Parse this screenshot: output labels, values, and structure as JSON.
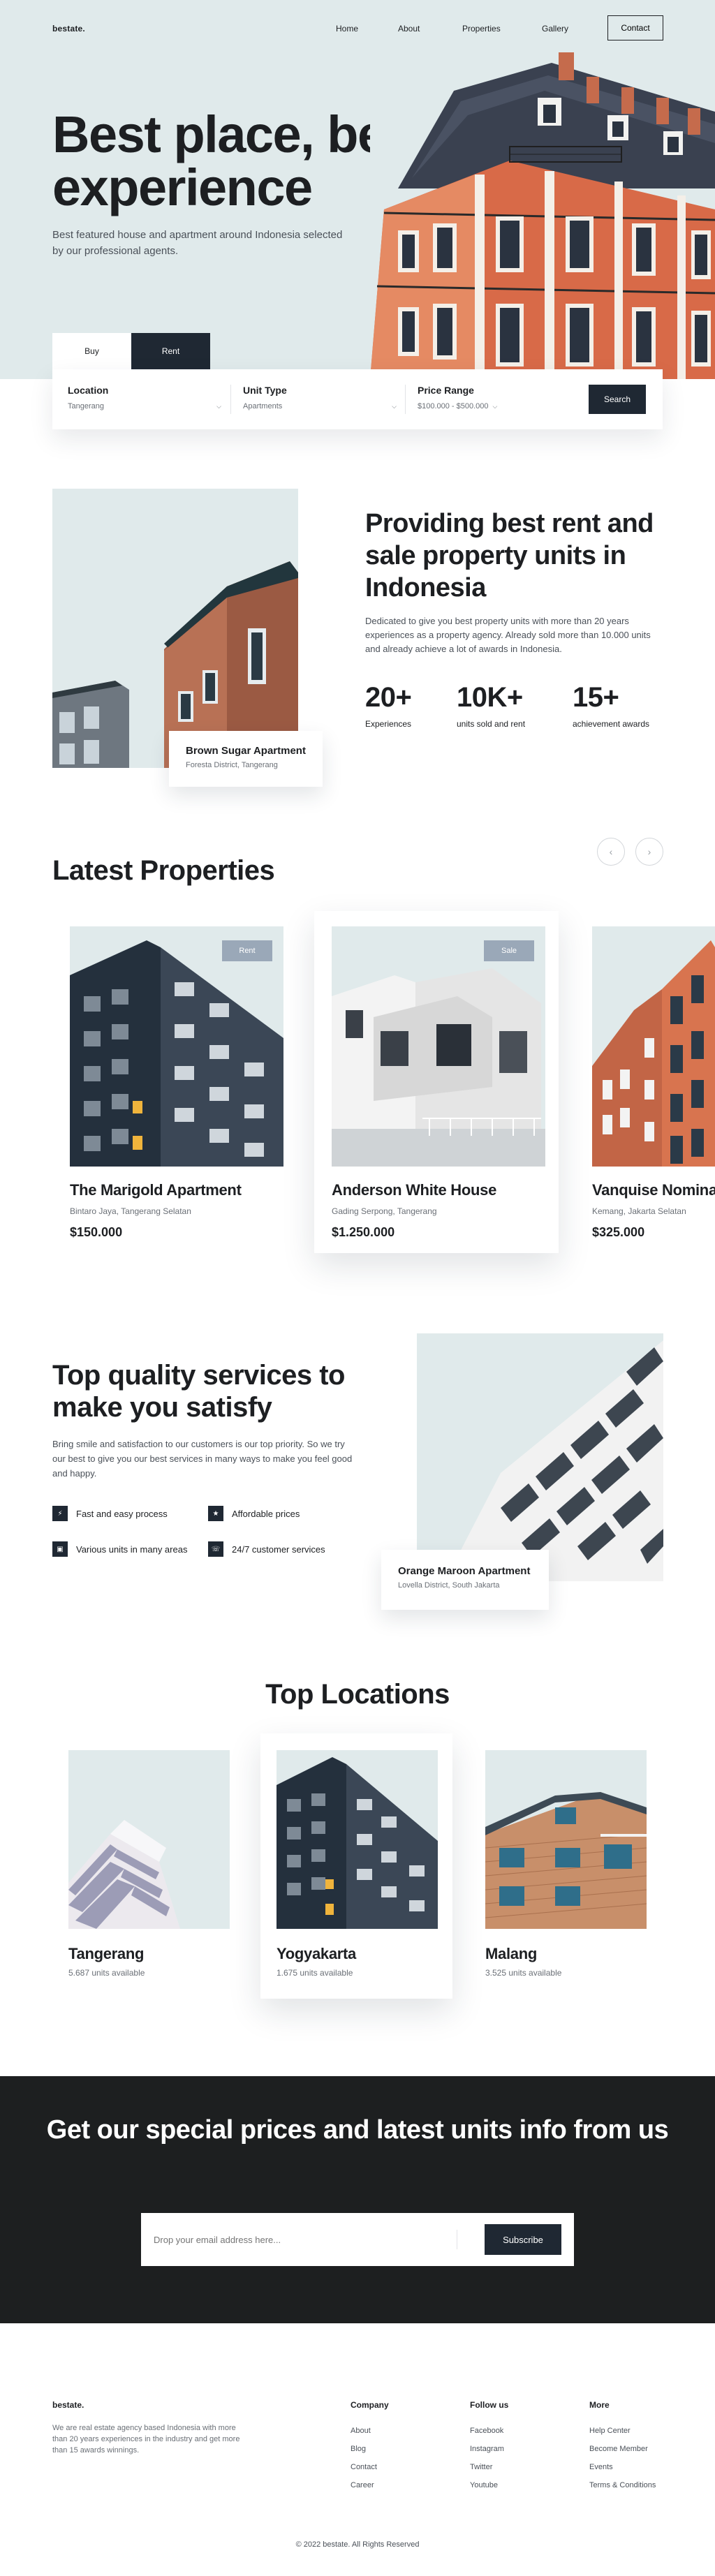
{
  "nav": {
    "logo": "bestate.",
    "links": [
      "Home",
      "About",
      "Properties",
      "Gallery"
    ],
    "contact": "Contact"
  },
  "hero": {
    "title": "Best place, best experience",
    "subtitle": "Best featured house and apartment around Indonesia selected by our professional agents.",
    "tabs": [
      "Buy",
      "Rent"
    ],
    "active_tab": "Buy",
    "fields": [
      {
        "label": "Location",
        "value": "Tangerang"
      },
      {
        "label": "Unit Type",
        "value": "Apartments"
      },
      {
        "label": "Price Range",
        "value": "$100.000 - $500.000"
      }
    ],
    "search_button": "Search"
  },
  "about": {
    "card_title": "Brown Sugar Apartment",
    "card_location": "Foresta District, Tangerang",
    "title": "Providing best rent and sale property units in Indonesia",
    "description": "Dedicated to give you best property units with more than 20 years experiences as a property agency. Already sold more than 10.000 units and already achieve a lot of awards in Indonesia.",
    "stats": [
      {
        "value": "20+",
        "label": "Experiences"
      },
      {
        "value": "10K+",
        "label": "units sold and rent"
      },
      {
        "value": "15+",
        "label": "achievement awards"
      }
    ]
  },
  "latest": {
    "title": "Latest Properties",
    "prev_icon": "chevron-left-icon",
    "next_icon": "chevron-right-icon",
    "properties": [
      {
        "name": "The Marigold Apartment",
        "location": "Bintaro Jaya, Tangerang Selatan",
        "price": "$150.000",
        "badge": "Rent"
      },
      {
        "name": "Anderson White House",
        "location": "Gading Serpong, Tangerang",
        "price": "$1.250.000",
        "badge": "Sale"
      },
      {
        "name": "Vanquise Nominal",
        "location": "Kemang, Jakarta Selatan",
        "price": "$325.000",
        "badge": ""
      }
    ]
  },
  "services": {
    "title": "Top quality services to make you satisfy",
    "description": "Bring smile and satisfaction to our customers is our top priority. So we try our best to give you our best services in many ways to make you feel good and happy.",
    "items": [
      {
        "label": "Fast and easy process",
        "icon": "lightning-icon"
      },
      {
        "label": "Affordable prices",
        "icon": "tag-icon"
      },
      {
        "label": "Various units in many areas",
        "icon": "grid-icon"
      },
      {
        "label": "24/7 customer services",
        "icon": "headset-icon"
      }
    ],
    "card_title": "Orange Maroon Apartment",
    "card_location": "Lovella District, South Jakarta"
  },
  "locations": {
    "title": "Top Locations",
    "items": [
      {
        "name": "Tangerang",
        "units": "5.687 units available"
      },
      {
        "name": "Yogyakarta",
        "units": "1.675 units available"
      },
      {
        "name": "Malang",
        "units": "3.525 units available"
      }
    ]
  },
  "cta": {
    "title": "Get our special prices and latest units info from us",
    "placeholder": "Drop your email address here...",
    "button": "Subscribe"
  },
  "footer": {
    "logo": "bestate.",
    "about": "We are real estate agency based Indonesia with more than 20 years experiences in the industry and get more than 15 awards winnings.",
    "columns": [
      {
        "title": "Company",
        "links": [
          "About",
          "Blog",
          "Contact",
          "Career"
        ]
      },
      {
        "title": "Follow us",
        "links": [
          "Facebook",
          "Instagram",
          "Twitter",
          "Youtube"
        ]
      },
      {
        "title": "More",
        "links": [
          "Help Center",
          "Become Member",
          "Events",
          "Terms & Conditions"
        ]
      }
    ],
    "copyright": "© 2022 bestate. All Rights Reserved"
  },
  "colors": {
    "accent": "#1f2833",
    "hero_bg": "#e0eaeb",
    "cta_bg": "#1d1f20",
    "badge": "#9aa8b8"
  }
}
